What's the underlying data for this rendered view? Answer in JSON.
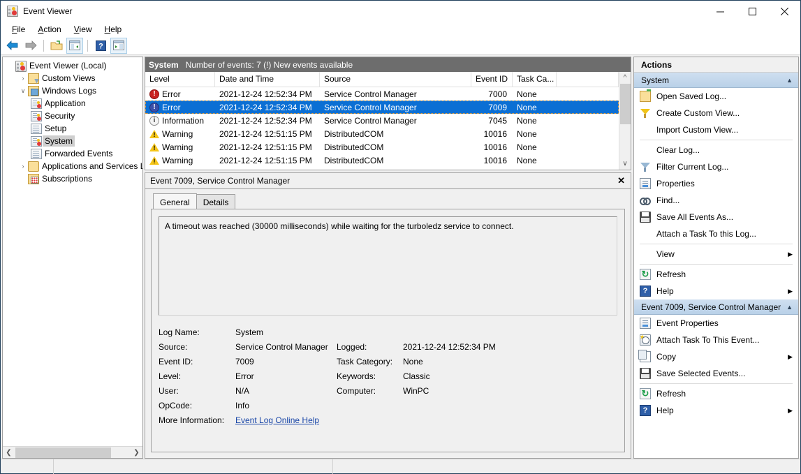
{
  "window": {
    "title": "Event Viewer",
    "app_icon": "event-viewer-icon",
    "controls": {
      "minimize": "minimize-icon",
      "maximize": "maximize-icon",
      "close": "close-icon"
    }
  },
  "menubar": [
    {
      "label": "File",
      "accel": "F"
    },
    {
      "label": "Action",
      "accel": "A"
    },
    {
      "label": "View",
      "accel": "V"
    },
    {
      "label": "Help",
      "accel": "H"
    }
  ],
  "toolbar": [
    {
      "name": "back-button",
      "icon": "left-arrow-icon"
    },
    {
      "name": "forward-button",
      "icon": "right-arrow-icon"
    },
    {
      "name": "open-folder-button",
      "icon": "open-folder-icon"
    },
    {
      "name": "show-hide-tree-button",
      "icon": "console-tree-icon"
    },
    {
      "name": "help-button",
      "icon": "question-mark-icon"
    },
    {
      "name": "show-hide-action-pane-button",
      "icon": "action-pane-icon"
    }
  ],
  "tree": {
    "root": {
      "label": "Event Viewer (Local)",
      "icon": "event-viewer-icon"
    },
    "items": [
      {
        "label": "Custom Views",
        "icon": "custom-views-folder-icon",
        "expander": "›",
        "level": 1,
        "selected": false
      },
      {
        "label": "Windows Logs",
        "icon": "windows-logs-folder-icon",
        "expander": "∨",
        "level": 1,
        "selected": false
      },
      {
        "label": "Application",
        "icon": "event-log-icon",
        "expander": "",
        "level": 2,
        "selected": false
      },
      {
        "label": "Security",
        "icon": "event-log-icon",
        "expander": "",
        "level": 2,
        "selected": false
      },
      {
        "label": "Setup",
        "icon": "log-icon",
        "expander": "",
        "level": 2,
        "selected": false
      },
      {
        "label": "System",
        "icon": "event-log-icon",
        "expander": "",
        "level": 2,
        "selected": true
      },
      {
        "label": "Forwarded Events",
        "icon": "log-icon",
        "expander": "",
        "level": 2,
        "selected": false
      },
      {
        "label": "Applications and Services Lo",
        "icon": "apps-services-folder-icon",
        "expander": "›",
        "level": 1,
        "selected": false
      },
      {
        "label": "Subscriptions",
        "icon": "subscriptions-folder-icon",
        "expander": "",
        "level": 1,
        "selected": false
      }
    ]
  },
  "list": {
    "log_name": "System",
    "summary": "Number of events: 7 (!) New events available",
    "columns": [
      "Level",
      "Date and Time",
      "Source",
      "Event ID",
      "Task Ca..."
    ],
    "rows": [
      {
        "level": "Error",
        "level_icon": "error-icon",
        "datetime": "2021-12-24 12:52:34 PM",
        "source": "Service Control Manager",
        "event_id": "7000",
        "task_category": "None",
        "selected": false
      },
      {
        "level": "Error",
        "level_icon": "error-icon",
        "datetime": "2021-12-24 12:52:34 PM",
        "source": "Service Control Manager",
        "event_id": "7009",
        "task_category": "None",
        "selected": true
      },
      {
        "level": "Information",
        "level_icon": "information-icon",
        "datetime": "2021-12-24 12:52:34 PM",
        "source": "Service Control Manager",
        "event_id": "7045",
        "task_category": "None",
        "selected": false
      },
      {
        "level": "Warning",
        "level_icon": "warning-icon",
        "datetime": "2021-12-24 12:51:15 PM",
        "source": "DistributedCOM",
        "event_id": "10016",
        "task_category": "None",
        "selected": false
      },
      {
        "level": "Warning",
        "level_icon": "warning-icon",
        "datetime": "2021-12-24 12:51:15 PM",
        "source": "DistributedCOM",
        "event_id": "10016",
        "task_category": "None",
        "selected": false
      },
      {
        "level": "Warning",
        "level_icon": "warning-icon",
        "datetime": "2021-12-24 12:51:15 PM",
        "source": "DistributedCOM",
        "event_id": "10016",
        "task_category": "None",
        "selected": false
      }
    ]
  },
  "detail": {
    "title": "Event 7009, Service Control Manager",
    "close_icon": "close-icon",
    "tabs": [
      {
        "label": "General",
        "active": true
      },
      {
        "label": "Details",
        "active": false
      }
    ],
    "description": "A timeout was reached (30000 milliseconds) while waiting for the turboledz service to connect.",
    "fields": {
      "log_name_label": "Log Name:",
      "log_name_value": "System",
      "source_label": "Source:",
      "source_value": "Service Control Manager",
      "logged_label": "Logged:",
      "logged_value": "2021-12-24 12:52:34 PM",
      "event_id_label": "Event ID:",
      "event_id_value": "7009",
      "task_category_label": "Task Category:",
      "task_category_value": "None",
      "level_label": "Level:",
      "level_value": "Error",
      "keywords_label": "Keywords:",
      "keywords_value": "Classic",
      "user_label": "User:",
      "user_value": "N/A",
      "computer_label": "Computer:",
      "computer_value": "WinPC",
      "opcode_label": "OpCode:",
      "opcode_value": "Info",
      "more_info_label": "More Information:",
      "more_info_link": "Event Log Online Help"
    }
  },
  "actions": {
    "header": "Actions",
    "sections": [
      {
        "title": "System",
        "chevron": "▲",
        "items": [
          {
            "label": "Open Saved Log...",
            "icon": "open-saved-log-icon",
            "submenu": false,
            "separator_after": false
          },
          {
            "label": "Create Custom View...",
            "icon": "create-custom-view-icon",
            "submenu": false,
            "separator_after": false
          },
          {
            "label": "Import Custom View...",
            "icon": "",
            "submenu": false,
            "separator_after": true
          },
          {
            "label": "Clear Log...",
            "icon": "",
            "submenu": false,
            "separator_after": false
          },
          {
            "label": "Filter Current Log...",
            "icon": "filter-icon",
            "submenu": false,
            "separator_after": false
          },
          {
            "label": "Properties",
            "icon": "properties-icon",
            "submenu": false,
            "separator_after": false
          },
          {
            "label": "Find...",
            "icon": "find-binoculars-icon",
            "submenu": false,
            "separator_after": false
          },
          {
            "label": "Save All Events As...",
            "icon": "save-icon",
            "submenu": false,
            "separator_after": false
          },
          {
            "label": "Attach a Task To this Log...",
            "icon": "",
            "submenu": false,
            "separator_after": true
          },
          {
            "label": "View",
            "icon": "",
            "submenu": true,
            "separator_after": true
          },
          {
            "label": "Refresh",
            "icon": "refresh-icon",
            "submenu": false,
            "separator_after": false
          },
          {
            "label": "Help",
            "icon": "help-icon",
            "submenu": true,
            "separator_after": false
          }
        ]
      },
      {
        "title": "Event 7009, Service Control Manager",
        "chevron": "▲",
        "items": [
          {
            "label": "Event Properties",
            "icon": "properties-icon",
            "submenu": false,
            "separator_after": false
          },
          {
            "label": "Attach Task To This Event...",
            "icon": "attach-task-icon",
            "submenu": false,
            "separator_after": false
          },
          {
            "label": "Copy",
            "icon": "copy-icon",
            "submenu": true,
            "separator_after": false
          },
          {
            "label": "Save Selected Events...",
            "icon": "save-icon",
            "submenu": false,
            "separator_after": true
          },
          {
            "label": "Refresh",
            "icon": "refresh-icon",
            "submenu": false,
            "separator_after": false
          },
          {
            "label": "Help",
            "icon": "help-icon",
            "submenu": true,
            "separator_after": false
          }
        ]
      }
    ]
  },
  "statusbar": {
    "segments": [
      "",
      "",
      ""
    ]
  },
  "colors": {
    "selection_blue": "#0b6fd4",
    "section_header_blue": "#bed5ea",
    "list_header_gray": "#6d6d6d",
    "error_red": "#c9221f",
    "warning_yellow": "#f5c518",
    "link_blue": "#1a47a8",
    "window_border": "#21405c"
  }
}
